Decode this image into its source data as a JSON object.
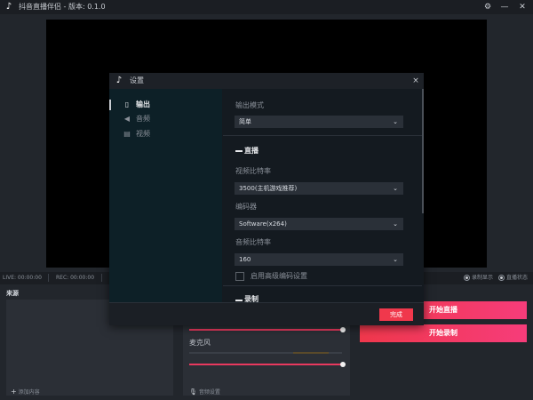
{
  "app": {
    "title": "抖音直播伴侣 - 版本: 0.1.0",
    "logo_glyph": "♪",
    "settings_glyph": "⚙",
    "minimize_glyph": "—",
    "close_glyph": "✕"
  },
  "status": {
    "live_time": "LIVE: 00:00:00",
    "rec_time": "REC: 00:00:00",
    "recording_display": "录制显示",
    "live_status": "直播状态"
  },
  "sources": {
    "title": "来源",
    "add_label": "添加内容"
  },
  "audio": {
    "mic_label": "麦克风",
    "settings_label": "音频设置",
    "desktop_volume": 1.0,
    "mic_volume": 1.0
  },
  "actions": {
    "start_live": "开始直播",
    "start_record": "开始录制"
  },
  "dialog": {
    "title": "设置",
    "close_glyph": "×",
    "sidebar": [
      {
        "label": "输出",
        "icon": "output-icon",
        "glyph": "▯",
        "active": true
      },
      {
        "label": "音频",
        "icon": "speaker-icon",
        "glyph": "◀",
        "active": false
      },
      {
        "label": "视频",
        "icon": "film-icon",
        "glyph": "▤",
        "active": false
      }
    ],
    "output_mode_label": "输出模式",
    "output_mode_value": "简单",
    "live_section": "直播",
    "video_bitrate_label": "视频比特率",
    "video_bitrate_value": "3500(主机游戏推荐)",
    "encoder_label": "编码器",
    "encoder_value": "Software(x264)",
    "audio_bitrate_label": "音频比特率",
    "audio_bitrate_value": "160",
    "advanced_encoder_label": "启用高级编码设置",
    "advanced_encoder_checked": false,
    "record_section": "录制",
    "done_button": "完成",
    "dropdown_glyph": "⌄"
  },
  "colors": {
    "accent": "#f0384c",
    "accent_pink": "#f63c7a",
    "sidebar_bg": "#0d2027",
    "window_bg": "#22262c"
  }
}
